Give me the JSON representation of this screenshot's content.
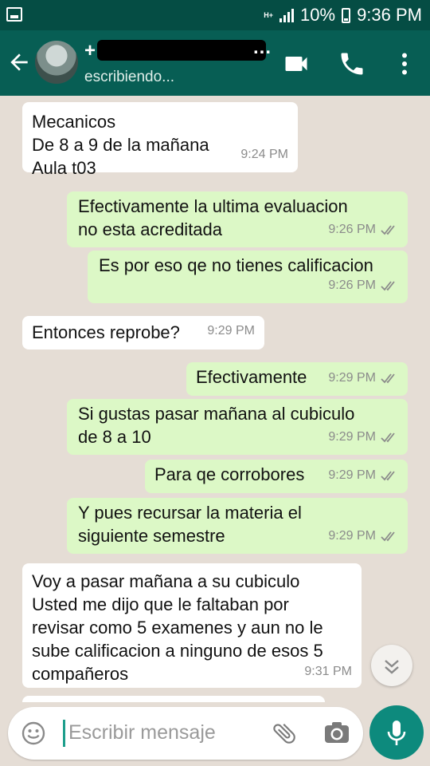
{
  "status_bar": {
    "network": "H+",
    "battery": "10%",
    "time": "9:36 PM"
  },
  "header": {
    "contact_name": "+",
    "contact_name_tail": "...",
    "status": "escribiendo..."
  },
  "messages": [
    {
      "dir": "in",
      "text": "Mecanicos\nDe 8  a 9 de la mañana\nAula t03",
      "time": "9:24 PM",
      "ticks": false
    },
    {
      "dir": "out",
      "text": "Efectivamente la ultima evaluacion\nno esta acreditada",
      "time": "9:26 PM",
      "ticks": true
    },
    {
      "dir": "out",
      "text": "Es por eso qe no tienes calificacion",
      "time": "9:26 PM",
      "ticks": true
    },
    {
      "dir": "in",
      "text": "Entonces reprobe?",
      "time": "9:29 PM",
      "ticks": false
    },
    {
      "dir": "out",
      "text": "Efectivamente",
      "time": "9:29 PM",
      "ticks": true
    },
    {
      "dir": "out",
      "text": "Si gustas pasar mañana al cubiculo\nde 8 a 10",
      "time": "9:29 PM",
      "ticks": true
    },
    {
      "dir": "out",
      "text": "Para qe corrobores",
      "time": "9:29 PM",
      "ticks": true
    },
    {
      "dir": "out",
      "text": "Y pues recursar la materia el\nsiguiente semestre",
      "time": "9:29 PM",
      "ticks": true
    },
    {
      "dir": "in",
      "text": "Voy a pasar mañana a su cubiculo\nUsted me dijo que le faltaban por\nrevisar como 5 examenes y aun no le\nsube calificacion a ninguno de esos 5\ncompañeros",
      "time": "9:31 PM",
      "ticks": false
    }
  ],
  "composer": {
    "placeholder": "Escribir mensaje"
  },
  "colors": {
    "header": "#075e54",
    "status_bar": "#054d44",
    "outgoing": "#dcf8c6",
    "incoming": "#ffffff",
    "accent": "#0d8a7d"
  },
  "icons": [
    "back-arrow-icon",
    "video-call-icon",
    "phone-icon",
    "more-vert-icon",
    "emoji-icon",
    "attach-icon",
    "camera-icon",
    "mic-icon",
    "scroll-down-icon",
    "double-check-icon"
  ]
}
